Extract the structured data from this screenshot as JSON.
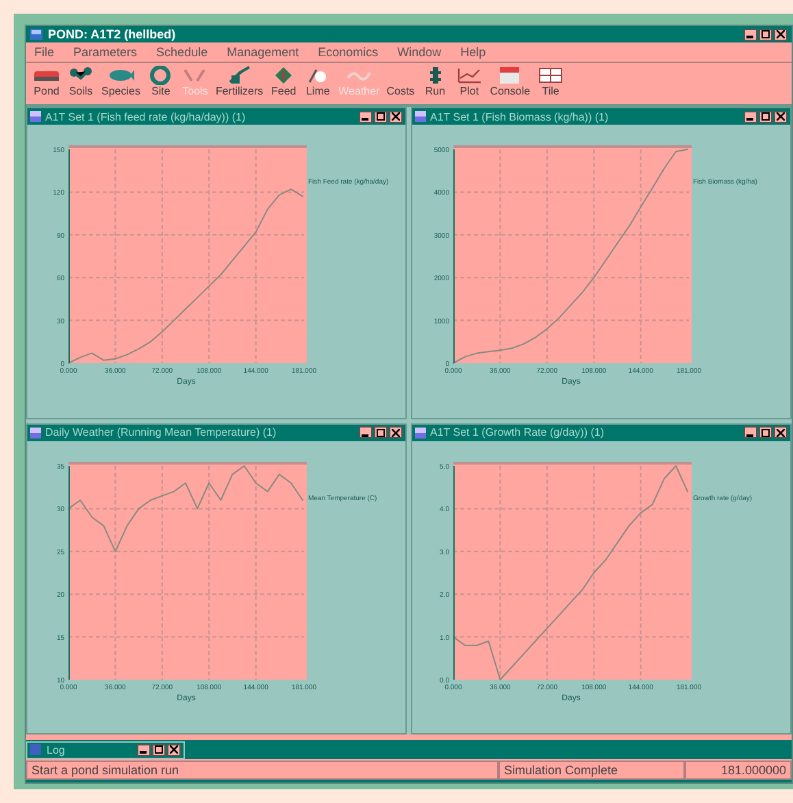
{
  "window": {
    "title": "POND: A1T2 (hellbed)"
  },
  "menu": [
    "File",
    "Parameters",
    "Schedule",
    "Management",
    "Economics",
    "Window",
    "Help"
  ],
  "toolbar": [
    {
      "label": "Pond",
      "disabled": false
    },
    {
      "label": "Soils",
      "disabled": false
    },
    {
      "label": "Species",
      "disabled": false
    },
    {
      "label": "Site",
      "disabled": false
    },
    {
      "label": "Tools",
      "disabled": true
    },
    {
      "label": "Fertilizers",
      "disabled": false
    },
    {
      "label": "Feed",
      "disabled": false
    },
    {
      "label": "Lime",
      "disabled": false
    },
    {
      "label": "Weather",
      "disabled": true
    },
    {
      "label": "Costs",
      "disabled": false
    },
    {
      "label": "Run",
      "disabled": false
    },
    {
      "label": "Plot",
      "disabled": false
    },
    {
      "label": "Console",
      "disabled": false
    },
    {
      "label": "Tile",
      "disabled": false
    }
  ],
  "plots": [
    {
      "title": "A1T Set 1 (Fish feed rate (kg/ha/day)) (1)",
      "chart_data": {
        "type": "line",
        "grid": true,
        "xlabel": "Days",
        "x": [
          0,
          9,
          18,
          27,
          36,
          45,
          54,
          63,
          72,
          81,
          90,
          99,
          108,
          117,
          126,
          135,
          144,
          153,
          162,
          171,
          180
        ],
        "xlim": [
          0,
          181
        ],
        "ylim": [
          0,
          150
        ],
        "xticks": [
          {
            "value": 0,
            "label": "0.000"
          },
          {
            "value": 36,
            "label": "36.000"
          },
          {
            "value": 72,
            "label": "72.000"
          },
          {
            "value": 108,
            "label": "108.000"
          },
          {
            "value": 144,
            "label": "144.000"
          },
          {
            "value": 181,
            "label": "181.000"
          }
        ],
        "yticks": [
          0,
          30,
          60,
          90,
          120,
          150
        ],
        "series": [
          {
            "name": "Fish Feed rate (kg/ha/day)",
            "color": "#8a8a80",
            "values": [
              0,
              4,
              7,
              2,
              3,
              6,
              10,
              15,
              22,
              30,
              38,
              46,
              54,
              62,
              72,
              82,
              92,
              108,
              118,
              122,
              117
            ]
          }
        ]
      }
    },
    {
      "title": "A1T Set 1 (Fish Biomass (kg/ha)) (1)",
      "chart_data": {
        "type": "line",
        "grid": true,
        "xlabel": "Days",
        "x": [
          0,
          9,
          18,
          27,
          36,
          45,
          54,
          63,
          72,
          81,
          90,
          99,
          108,
          117,
          126,
          135,
          144,
          153,
          162,
          171,
          180
        ],
        "xlim": [
          0,
          181
        ],
        "ylim": [
          0,
          5000
        ],
        "xticks": [
          {
            "value": 0,
            "label": "0.000"
          },
          {
            "value": 36,
            "label": "36.000"
          },
          {
            "value": 72,
            "label": "72.000"
          },
          {
            "value": 108,
            "label": "108.000"
          },
          {
            "value": 144,
            "label": "144.000"
          },
          {
            "value": 181,
            "label": "181.000"
          }
        ],
        "yticks": [
          0,
          1000,
          2000,
          3000,
          4000,
          5000
        ],
        "series": [
          {
            "name": "Fish Biomass (kg/ha)",
            "color": "#8a8a80",
            "values": [
              0,
              150,
              230,
              270,
              300,
              350,
              450,
              600,
              800,
              1050,
              1350,
              1650,
              2000,
              2400,
              2800,
              3200,
              3650,
              4100,
              4550,
              4950,
              5000
            ]
          }
        ]
      }
    },
    {
      "title": "Daily Weather (Running Mean Temperature) (1)",
      "chart_data": {
        "type": "line",
        "grid": true,
        "xlabel": "Days",
        "x": [
          0,
          9,
          18,
          27,
          36,
          45,
          54,
          63,
          72,
          81,
          90,
          99,
          108,
          117,
          126,
          135,
          144,
          153,
          162,
          171,
          180
        ],
        "xlim": [
          0,
          181
        ],
        "ylim": [
          10,
          35
        ],
        "xticks": [
          {
            "value": 0,
            "label": "0.000"
          },
          {
            "value": 36,
            "label": "36.000"
          },
          {
            "value": 72,
            "label": "72.000"
          },
          {
            "value": 108,
            "label": "108.000"
          },
          {
            "value": 144,
            "label": "144.000"
          },
          {
            "value": 181,
            "label": "181.000"
          }
        ],
        "yticks": [
          10,
          15,
          20,
          25,
          30,
          35
        ],
        "series": [
          {
            "name": "Mean Temperature (C)",
            "color": "#8a8a80",
            "values": [
              30,
              31,
              29,
              28,
              25,
              28,
              30,
              31,
              31.5,
              32,
              33,
              30,
              33,
              31,
              34,
              35,
              33,
              32,
              34,
              33,
              31
            ]
          }
        ]
      }
    },
    {
      "title": "A1T Set 1 (Growth Rate (g/day)) (1)",
      "chart_data": {
        "type": "line",
        "grid": true,
        "xlabel": "Days",
        "x": [
          0,
          9,
          18,
          27,
          36,
          45,
          54,
          63,
          72,
          81,
          90,
          99,
          108,
          117,
          126,
          135,
          144,
          153,
          162,
          171,
          180
        ],
        "xlim": [
          0,
          181
        ],
        "ylim": [
          0,
          5
        ],
        "xticks": [
          {
            "value": 0,
            "label": "0.000"
          },
          {
            "value": 36,
            "label": "36.000"
          },
          {
            "value": 72,
            "label": "72.000"
          },
          {
            "value": 108,
            "label": "108.000"
          },
          {
            "value": 144,
            "label": "144.000"
          },
          {
            "value": 181,
            "label": "181.000"
          }
        ],
        "yticks": [
          {
            "value": 0,
            "label": "0.0"
          },
          {
            "value": 1,
            "label": "1.0"
          },
          {
            "value": 2,
            "label": "2.0"
          },
          {
            "value": 3,
            "label": "3.0"
          },
          {
            "value": 4,
            "label": "4.0"
          },
          {
            "value": 5,
            "label": "5.0"
          }
        ],
        "series": [
          {
            "name": "Growth rate (g/day)",
            "color": "#8a8a80",
            "values": [
              1.0,
              0.8,
              0.8,
              0.9,
              0.0,
              0.3,
              0.6,
              0.9,
              1.2,
              1.5,
              1.8,
              2.1,
              2.5,
              2.8,
              3.2,
              3.6,
              3.9,
              4.1,
              4.7,
              5.0,
              4.4
            ]
          }
        ]
      }
    }
  ],
  "minimized": {
    "title": "Log"
  },
  "status_bar": [
    "Start a pond simulation run",
    "Simulation Complete",
    "181.000000"
  ]
}
